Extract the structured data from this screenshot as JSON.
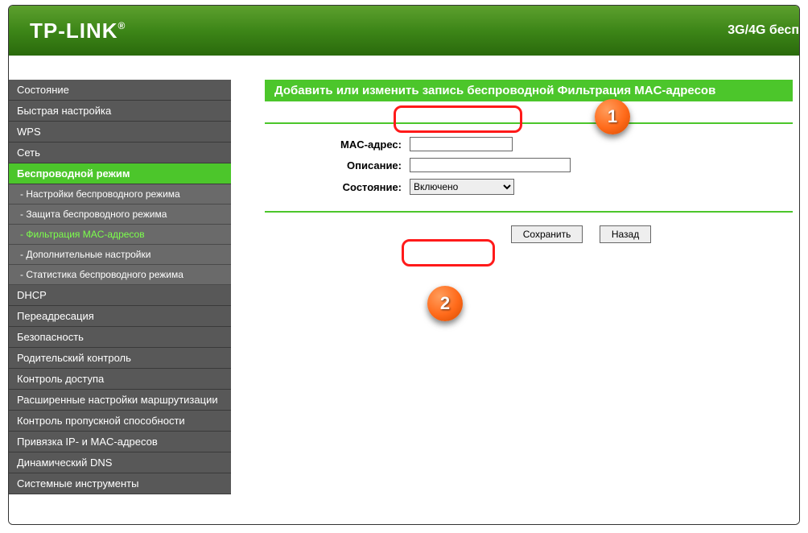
{
  "header": {
    "logo": "TP-LINK",
    "right_text": "3G/4G бесп"
  },
  "sidebar": {
    "items": [
      {
        "label": "Состояние",
        "type": "main"
      },
      {
        "label": "Быстрая настройка",
        "type": "main"
      },
      {
        "label": "WPS",
        "type": "main"
      },
      {
        "label": "Сеть",
        "type": "main"
      },
      {
        "label": "Беспроводной режим",
        "type": "main",
        "active": true
      },
      {
        "label": "- Настройки беспроводного режима",
        "type": "sub"
      },
      {
        "label": "- Защита беспроводного режима",
        "type": "sub"
      },
      {
        "label": "- Фильтрация MAC-адресов",
        "type": "sub",
        "selected": true
      },
      {
        "label": "- Дополнительные настройки",
        "type": "sub"
      },
      {
        "label": "- Статистика беспроводного режима",
        "type": "sub"
      },
      {
        "label": "DHCP",
        "type": "main"
      },
      {
        "label": "Переадресация",
        "type": "main"
      },
      {
        "label": "Безопасность",
        "type": "main"
      },
      {
        "label": "Родительский контроль",
        "type": "main"
      },
      {
        "label": "Контроль доступа",
        "type": "main"
      },
      {
        "label": "Расширенные настройки маршрутизации",
        "type": "main"
      },
      {
        "label": "Контроль пропускной способности",
        "type": "main"
      },
      {
        "label": "Привязка IP- и MAC-адресов",
        "type": "main"
      },
      {
        "label": "Динамический DNS",
        "type": "main"
      },
      {
        "label": "Системные инструменты",
        "type": "main"
      }
    ]
  },
  "content": {
    "title": "Добавить или изменить запись беспроводной Фильтрация MAC-адресов",
    "form": {
      "mac_label": "MAC-адрес:",
      "mac_value": "",
      "desc_label": "Описание:",
      "desc_value": "",
      "state_label": "Состояние:",
      "state_value": "Включено"
    },
    "buttons": {
      "save": "Сохранить",
      "back": "Назад"
    }
  },
  "annotations": {
    "badge1": "1",
    "badge2": "2"
  }
}
